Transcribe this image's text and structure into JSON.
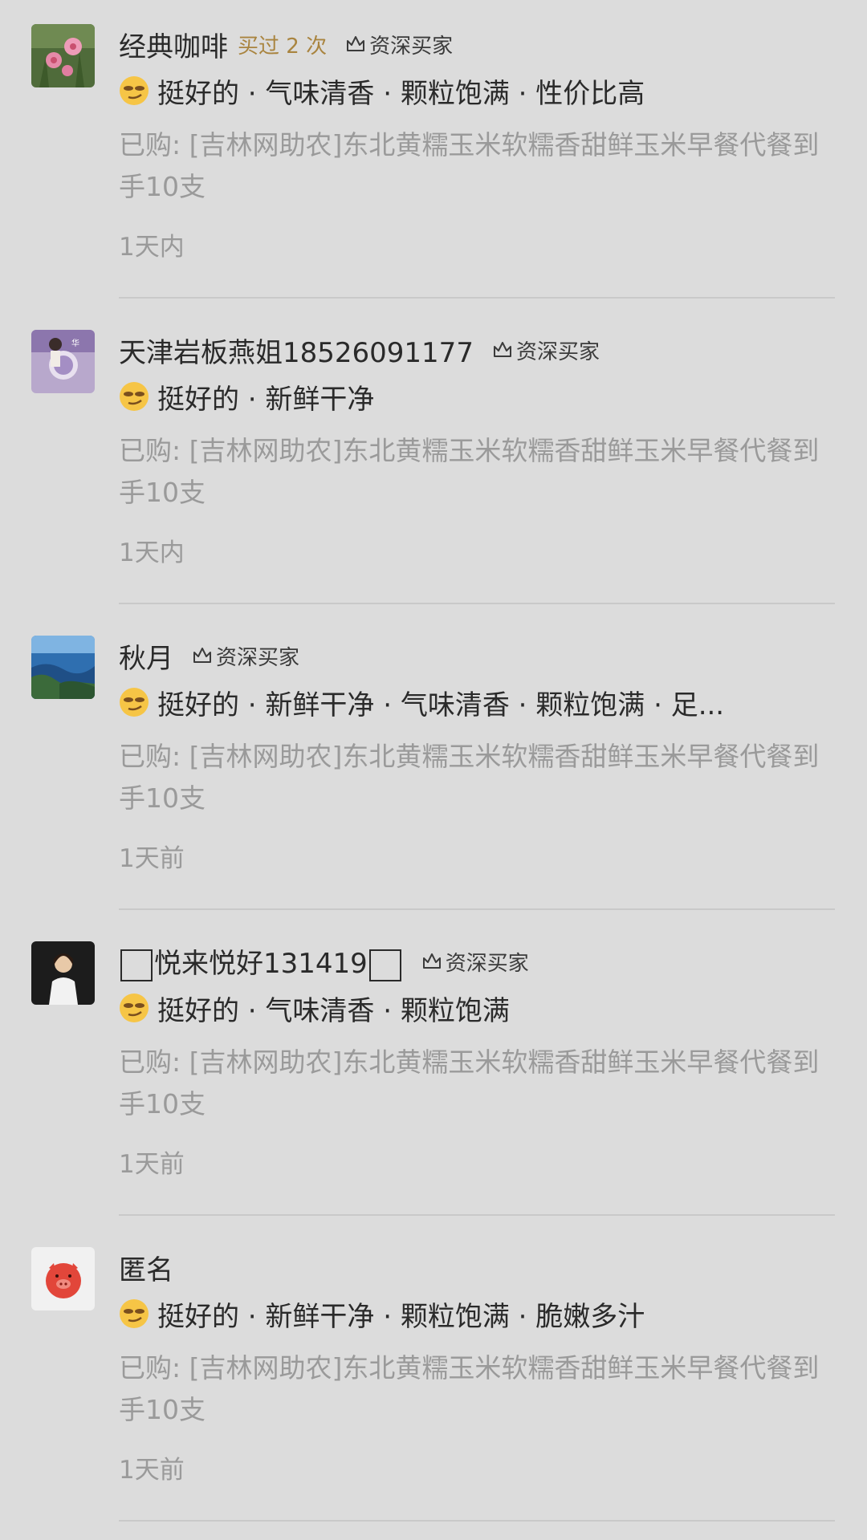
{
  "reviews": [
    {
      "username": "经典咖啡",
      "bought_count": "买过 2 次",
      "badge": "资深买家",
      "tags": "挺好的 · 气味清香 · 颗粒饱满 · 性价比高",
      "purchase": "已购: [吉林网助农]东北黄糯玉米软糯香甜鲜玉米早餐代餐到手10支",
      "time": "1天内"
    },
    {
      "username": "天津岩板燕姐18526091177",
      "badge": "资深买家",
      "tags": "挺好的 · 新鲜干净",
      "purchase": "已购: [吉林网助农]东北黄糯玉米软糯香甜鲜玉米早餐代餐到手10支",
      "time": "1天内"
    },
    {
      "username": "秋月",
      "badge": "资深买家",
      "tags": "挺好的 · 新鲜干净 · 气味清香 · 颗粒饱满 · 足...",
      "purchase": "已购: [吉林网助农]东北黄糯玉米软糯香甜鲜玉米早餐代餐到手10支",
      "time": "1天前"
    },
    {
      "username": "悦来悦好131419",
      "badge": "资深买家",
      "tags": "挺好的 · 气味清香 · 颗粒饱满",
      "purchase": "已购: [吉林网助农]东北黄糯玉米软糯香甜鲜玉米早餐代餐到手10支",
      "time": "1天前"
    },
    {
      "username": "匿名",
      "tags": "挺好的 · 新鲜干净 · 颗粒饱满 · 脆嫩多汁",
      "purchase": "已购: [吉林网助农]东北黄糯玉米软糯香甜鲜玉米早餐代餐到手10支",
      "time": "1天前"
    }
  ],
  "icons": {
    "badge": "crown-icon",
    "emoji": "smirk-emoji-icon"
  },
  "colors": {
    "background": "#dcdcdc",
    "bought_count": "#a9843f",
    "secondary_text": "#9a9a9a",
    "primary_text": "#2a2a2a"
  }
}
